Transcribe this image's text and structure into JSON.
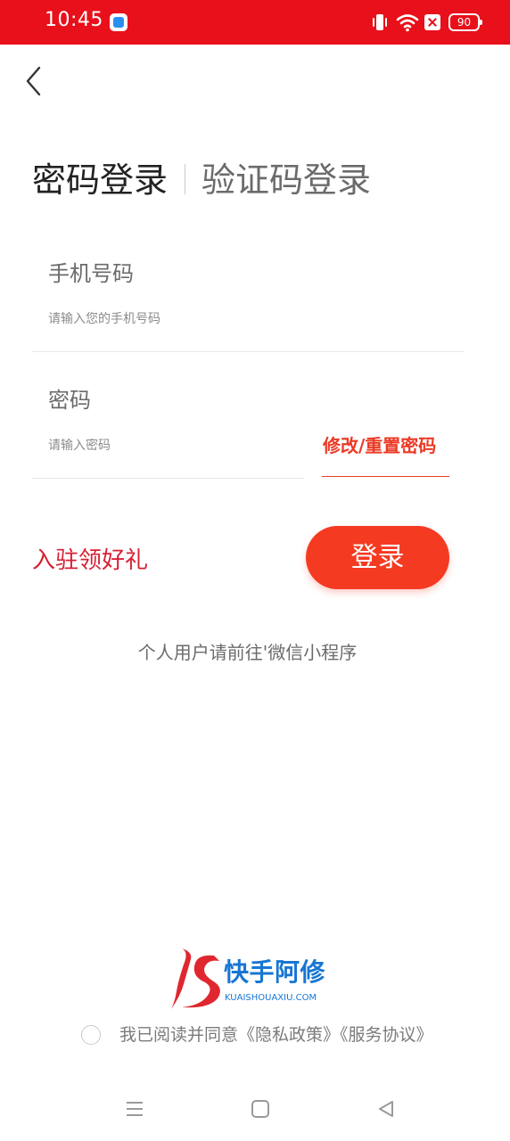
{
  "status_bar": {
    "time": "10:45",
    "battery_level": "90",
    "icons": [
      "app-icon",
      "vibrate-icon",
      "wifi-icon",
      "sim-icon",
      "battery-icon"
    ],
    "background": "#e8101a"
  },
  "tabs": {
    "password": "密码登录",
    "code": "验证码登录"
  },
  "phone": {
    "label": "手机号码",
    "placeholder": "请输入您的手机号码"
  },
  "password": {
    "label": "密码",
    "placeholder": "请输入密码",
    "reset_link": "修改/重置密码"
  },
  "actions": {
    "join_link": "入驻领好礼",
    "login_button": "登录",
    "miniprogram_tip": "个人用户请前往'微信小程序"
  },
  "logo": {
    "name": "快手阿修",
    "domain": "KUAISHOUAXIU.COM"
  },
  "agreement": {
    "text": "我已阅读并同意《隐私政策》《服务协议》",
    "checked": false
  },
  "colors": {
    "accent": "#f53a22",
    "link_red": "#ea3a25",
    "join_red": "#d81f34",
    "logo_blue": "#1876d3"
  }
}
